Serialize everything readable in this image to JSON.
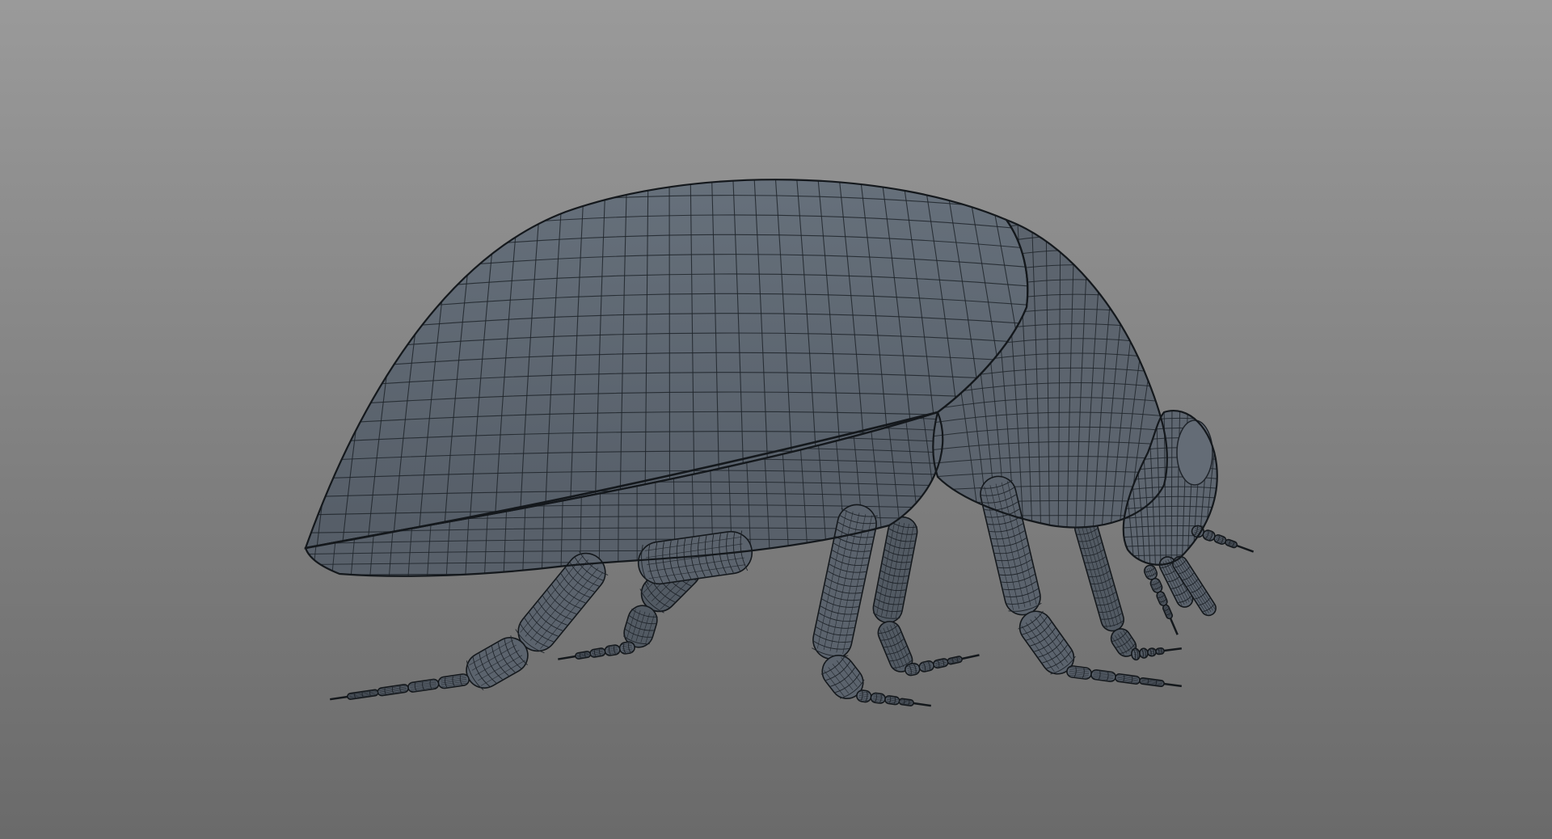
{
  "viewport": {
    "background_top": "#9a9a9a",
    "background_bottom": "#6a6a6a",
    "mesh_fill": "#5b636d",
    "mesh_fill_light": "#6b737d",
    "wire_color": "#1f242a",
    "outline_color": "#14181c"
  },
  "model": {
    "subject": "beetle",
    "display_mode": "wireframe-on-shaded"
  }
}
